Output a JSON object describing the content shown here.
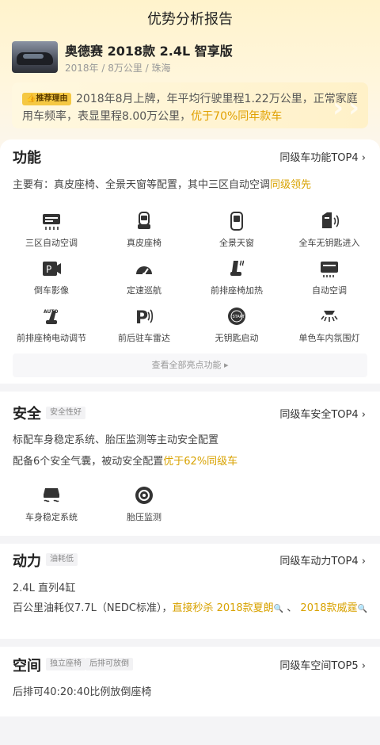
{
  "page_title": "优势分析报告",
  "car": {
    "name": "奥德赛 2018款 2.4L 智享版",
    "meta": "2018年 / 8万公里 / 珠海"
  },
  "reason": {
    "tag": "推荐理由",
    "text": "2018年8月上牌，年平均行驶里程1.22万公里，正常家庭用车频率，表显里程8.00万公里，",
    "highlight": "优于70%同年款车"
  },
  "function_section": {
    "title": "功能",
    "right_link": "同级车功能TOP4",
    "summary": "主要有：真皮座椅、全景天窗等配置，其中三区自动空调",
    "summary_highlight": "同级领先",
    "features": [
      {
        "label": "三区自动空调",
        "icon": "climate-icon"
      },
      {
        "label": "真皮座椅",
        "icon": "leather-seat-icon"
      },
      {
        "label": "全景天窗",
        "icon": "sunroof-icon"
      },
      {
        "label": "全车无钥匙进入",
        "icon": "keyless-entry-icon"
      },
      {
        "label": "倒车影像",
        "icon": "reverse-camera-icon"
      },
      {
        "label": "定速巡航",
        "icon": "cruise-control-icon"
      },
      {
        "label": "前排座椅加热",
        "icon": "seat-heating-icon"
      },
      {
        "label": "自动空调",
        "icon": "auto-ac-icon"
      },
      {
        "label": "前排座椅电动调节",
        "icon": "power-seat-icon"
      },
      {
        "label": "前后驻车雷达",
        "icon": "parking-radar-icon"
      },
      {
        "label": "无钥匙启动",
        "icon": "start-button-icon"
      },
      {
        "label": "单色车内氛围灯",
        "icon": "ambient-light-icon"
      }
    ],
    "more_label": "查看全部亮点功能 ▸"
  },
  "safety_section": {
    "title": "安全",
    "tag": "安全性好",
    "right_link": "同级车安全TOP4",
    "line1": "标配车身稳定系统、胎压监测等主动安全配置",
    "line2": "配备6个安全气囊，被动安全配置",
    "line2_highlight": "优于62%同级车",
    "features": [
      {
        "label": "车身稳定系统",
        "icon": "stability-control-icon"
      },
      {
        "label": "胎压监测",
        "icon": "tire-pressure-icon"
      }
    ]
  },
  "power_section": {
    "title": "动力",
    "tag": "油耗低",
    "right_link": "同级车动力TOP4",
    "line1": "2.4L 直列4缸",
    "line2": "百公里油耗仅7.7L（NEDC标准），",
    "line2_highlight": "直接秒杀 2018款夏朗",
    "sep": "、",
    "line2_highlight2": "2018款威霆"
  },
  "space_section": {
    "title": "空间",
    "tags": [
      "独立座椅",
      "后排可放倒"
    ],
    "right_link": "同级车空间TOP5",
    "line1": "后排可40:20:40比例放倒座椅"
  },
  "colors": {
    "accent": "#e0a000",
    "header_bg": "#fff3cc",
    "tag_bg": "#f5c843"
  }
}
